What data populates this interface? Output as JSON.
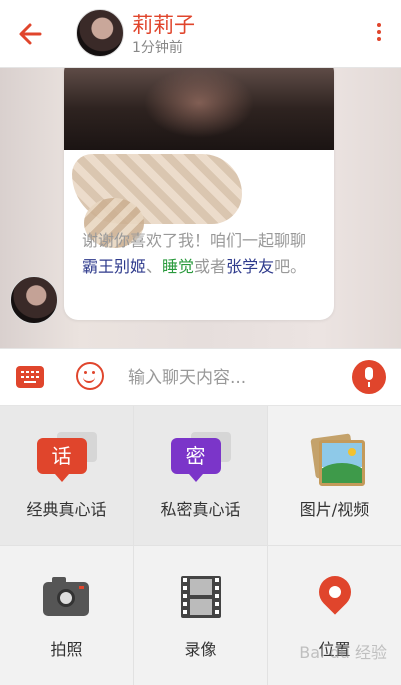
{
  "header": {
    "back_icon": "arrow-left-icon",
    "contact_name": "莉莉子",
    "status": "1分钟前",
    "more_icon": "more-vertical-icon"
  },
  "chat": {
    "message_prefix": "谢谢你喜欢了我！咱们一起聊聊",
    "keyword_1": "霸王别姬",
    "separator_1": "、",
    "keyword_2": "睡觉",
    "separator_2": "或者",
    "keyword_3": "张学友",
    "message_suffix": "吧。"
  },
  "input": {
    "keyboard_icon": "keyboard-icon",
    "emoji_icon": "smiley-icon",
    "placeholder": "输入聊天内容...",
    "mic_icon": "microphone-icon"
  },
  "menu": {
    "classic_truth": {
      "badge": "话",
      "label": "经典真心话",
      "color": "#e0452c"
    },
    "private_truth": {
      "badge": "密",
      "label": "私密真心话",
      "color": "#7b35c9"
    },
    "photo_video": {
      "label": "图片/视频"
    },
    "camera": {
      "label": "拍照"
    },
    "record": {
      "label": "录像"
    },
    "location": {
      "label": "位置"
    }
  },
  "watermark": "Bai du 经验",
  "colors": {
    "accent": "#e0452c"
  }
}
